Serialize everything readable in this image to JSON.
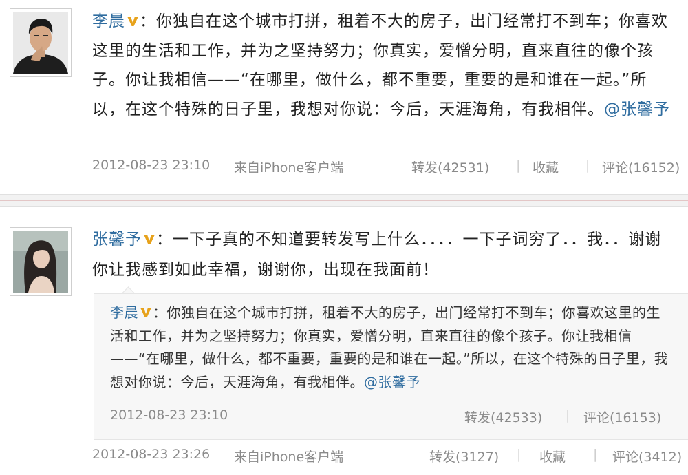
{
  "post1": {
    "author": "李晨",
    "text": "：你独自在这个城市打拼，租着不大的房子，出门经常打不到车；你喜欢这里的生活和工作，并为之坚持努力；你真实，爱憎分明，直来直往的像个孩子。你让我相信——“在哪里，做什么，都不重要，重要的是和谁在一起。”所以，在这个特殊的日子里，我想对你说：今后，天涯海角，有我相伴。",
    "mention": "@张馨予",
    "timestamp": "2012-08-23 23:10",
    "source": "来自iPhone客户端",
    "repost_label": "转发(42531)",
    "favorite_label": "收藏",
    "comment_label": "评论(16152)"
  },
  "post2": {
    "author": "张馨予",
    "text": "：一下子真的不知道要转发写上什么．．．．一下子词穷了．．我．．谢谢你让我感到如此幸福，谢谢你，出现在我面前！",
    "quoted": {
      "author": "李晨",
      "text": "：你独自在这个城市打拼，租着不大的房子，出门经常打不到车；你喜欢这里的生活和工作，并为之坚持努力；你真实，爱憎分明，直来直往的像个孩子。你让我相信——“在哪里，做什么，都不重要，重要的是和谁在一起。”所以，在这个特殊的日子里，我想对你说：今后，天涯海角，有我相伴。",
      "mention": "@张馨予",
      "timestamp": "2012-08-23 23:10",
      "repost_label": "转发(42533)",
      "comment_label": "评论(16153)"
    },
    "timestamp": "2012-08-23 23:26",
    "source": "来自iPhone客户端",
    "repost_label": "转发(3127)",
    "favorite_label": "收藏",
    "comment_label": "评论(3412)"
  },
  "separator": "|",
  "colors": {
    "link": "#2f6c9f",
    "meta": "#8a8a8a",
    "badge": "#e7a21b"
  },
  "icons": {
    "verified_badge": "v-verified-icon"
  }
}
